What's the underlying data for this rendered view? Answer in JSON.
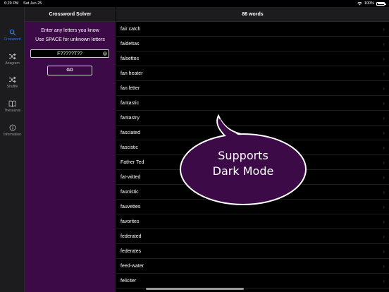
{
  "status": {
    "time": "6:29 PM",
    "date": "Sat Jun 25",
    "battery": "100%",
    "battery_level": 1.0
  },
  "tabs": [
    {
      "label": "Crossword",
      "icon": "search-icon",
      "active": true
    },
    {
      "label": "Anagram",
      "icon": "shuffle-icon",
      "active": false
    },
    {
      "label": "Shuffle",
      "icon": "shuffle-icon",
      "active": false
    },
    {
      "label": "Thesaurus",
      "icon": "book-icon",
      "active": false
    },
    {
      "label": "Information",
      "icon": "info-icon",
      "active": false
    }
  ],
  "left": {
    "title": "Crossword Solver",
    "instruction_line1": "Enter any letters you know",
    "instruction_line2": "Use SPACE for unknown letters",
    "query": "F?????T??",
    "go_label": "GO"
  },
  "right": {
    "title": "86 words",
    "words": [
      "fair catch",
      "faldettas",
      "falsettos",
      "fan heater",
      "fan letter",
      "fantastic",
      "fantastry",
      "fasciated",
      "fascistic",
      "Father Ted",
      "fat-witted",
      "faunistic",
      "fauvettes",
      "favorites",
      "federated",
      "federates",
      "feed-water",
      "feliciter"
    ]
  },
  "callout": {
    "line1": "Supports",
    "line2": "Dark Mode",
    "fill": "#3b0a47"
  },
  "colors": {
    "accent": "#2a7bff",
    "panel_purple": "#3b0a47",
    "header_bg": "#1c1c1e"
  }
}
